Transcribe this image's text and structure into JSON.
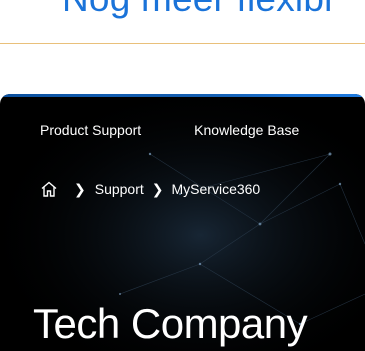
{
  "promo": {
    "text": "Nog meer flexibi"
  },
  "nav": {
    "items": [
      "Product Support",
      "Knowledge Base"
    ]
  },
  "breadcrumb": {
    "items": [
      "Support",
      "MyService360"
    ]
  },
  "page": {
    "title": "Tech Company"
  },
  "colors": {
    "promo_blue": "#1a73d9",
    "accent_line": "#e9c07a",
    "panel_bg": "#000000"
  },
  "icons": {
    "home": "home-icon",
    "separator": "chevron-right-icon"
  }
}
